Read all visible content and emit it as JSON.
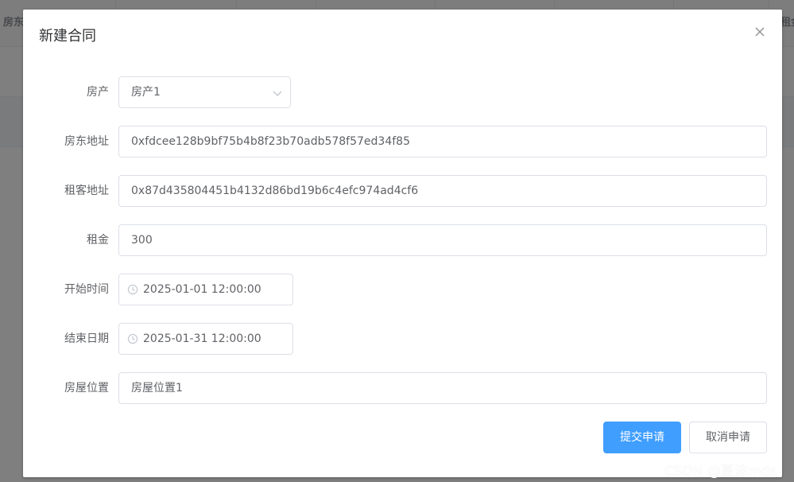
{
  "background": {
    "table_header_left": "房东",
    "table_header_right": "租金"
  },
  "dialog": {
    "title": "新建合同",
    "close_icon": "close-icon"
  },
  "form": {
    "property": {
      "label": "房产",
      "value": "房产1",
      "icon": "chevron-down-icon"
    },
    "landlord_address": {
      "label": "房东地址",
      "value": "0xfdcee128b9bf75b4b8f23b70adb578f57ed34f85"
    },
    "tenant_address": {
      "label": "租客地址",
      "value": "0x87d435804451b4132d86bd19b6c4efc974ad4cf6"
    },
    "rent": {
      "label": "租金",
      "value": "300"
    },
    "start_time": {
      "label": "开始时间",
      "value": "2025-01-01 12:00:00",
      "icon": "clock-icon"
    },
    "end_date": {
      "label": "结束日期",
      "value": "2025-01-31 12:00:00",
      "icon": "clock-icon"
    },
    "location": {
      "label": "房屋位置",
      "value": "房屋位置1"
    }
  },
  "actions": {
    "submit_label": "提交申请",
    "cancel_label": "取消申请"
  },
  "watermark": "CSDN @夏沫mds",
  "colors": {
    "primary": "#409eff",
    "border": "#dcdfe6",
    "text": "#606266",
    "title": "#303133"
  }
}
